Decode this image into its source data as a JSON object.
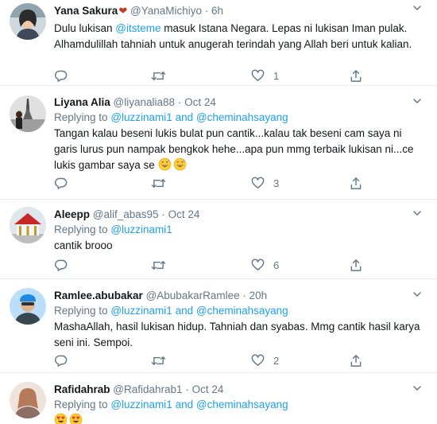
{
  "tweets": [
    {
      "name": "Yana Sakura",
      "name_suffix": "❤",
      "handle": "@YanaMichiyo",
      "time": "6h",
      "reply_prefix": "",
      "reply_to_1": "",
      "reply_joiner": "",
      "reply_to_2": "",
      "body_1": "Dulu lukisan ",
      "body_mention": "@itsteme",
      "body_2": " masuk Istana Negara. Lepas ni lukisan Iman pulak. Alhamdulillah tahniah untuk anugerah terindah yang Allah beri untuk kalian.",
      "likes": "1"
    },
    {
      "name": "Liyana Alia",
      "handle": "@liyanalia88",
      "time": "Oct 24",
      "reply_prefix": "Replying to",
      "reply_to_1": "@luzzinami1",
      "reply_joiner": "and",
      "reply_to_2": "@cheminahsayang",
      "body": "Tangan kalau beseni lukis bulat pun cantik...kalau tak beseni cam saya ni garis lurus pun nampak bengkok hehe...apa pun mmg terbaik lukisan ni...ce lukis gambar saya se",
      "emoji": [
        "grinning-sweat-emoji",
        "grinning-sweat-emoji"
      ],
      "likes": "3"
    },
    {
      "name": "Aleepp",
      "handle": "@alif_abas95",
      "time": "Oct 24",
      "reply_prefix": "Replying to",
      "reply_to_1": "@luzzinami1",
      "body": "cantik brooo",
      "likes": "6"
    },
    {
      "name": "Ramlee.abubakar",
      "handle": "@AbubakarRamlee",
      "time": "20h",
      "reply_prefix": "Replying to",
      "reply_to_1": "@luzzinami1",
      "reply_joiner": "and",
      "reply_to_2": "@cheminahsayang",
      "body": "MashaAllah, hasil lukisan hidup. Tahniah dan syabas. Mmg cantik hasil karya seni ini. Sempoi.",
      "likes": "2"
    },
    {
      "name": "Rafidahrab",
      "handle": "@Rafidahrab1",
      "time": "Oct 24",
      "reply_prefix": "Replying to",
      "reply_to_1": "@luzzinami1",
      "reply_joiner": "and",
      "reply_to_2": "@cheminahsayang",
      "emoji": [
        "heart-eyes-emoji",
        "heart-eyes-emoji"
      ]
    }
  ],
  "separator": "·",
  "icons": {
    "reply": "reply-icon",
    "retweet": "retweet-icon",
    "like": "like-icon",
    "share": "share-icon",
    "more": "chevron-down-icon"
  },
  "colors": {
    "link": "#1da1f2",
    "muted": "#657786",
    "text": "#14171a",
    "heart": "#c0392b",
    "divider": "#e6ecf0"
  }
}
